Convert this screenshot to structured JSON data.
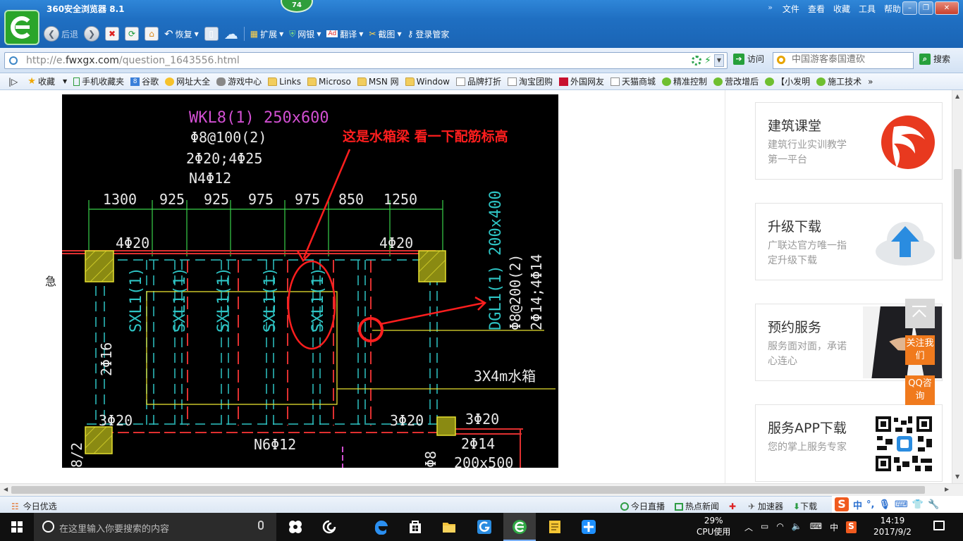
{
  "browser": {
    "title": "360安全浏览器 8.1",
    "badge": "74",
    "menu": [
      "文件",
      "查看",
      "收藏",
      "工具",
      "帮助"
    ],
    "nav": {
      "back": "后退",
      "restore": "恢复",
      "extend": "扩展",
      "bank": "网银",
      "translate": "翻译",
      "screenshot": "截图",
      "login_manager": "登录管家"
    },
    "address": {
      "prefix": "http://e.",
      "domain": "fwxgx.com",
      "path": "/question_1643556.html",
      "visit": "访问"
    },
    "search": {
      "placeholder": "中国游客泰国遭砍",
      "button": "搜索"
    },
    "favorites": [
      "收藏",
      "手机收藏夹",
      "谷歌",
      "网址大全",
      "游戏中心",
      "Links",
      "Microso",
      "MSN 网",
      "Window",
      "品牌打折",
      "淘宝团购",
      "外国网友",
      "天猫商城",
      "精准控制",
      "营改增后",
      "【小发明",
      "施工技术"
    ]
  },
  "page": {
    "left_label": "急",
    "drawing_annotation": "这是水箱梁 看一下配筋标高",
    "drawing_text": {
      "beam": "WKL8(1) 250x600",
      "stirrup": "Φ8@100(2)",
      "bars": "2Φ20;4Φ25",
      "torsion": "N4Φ12",
      "dims": [
        "1300",
        "925",
        "925",
        "975",
        "975",
        "850",
        "1250"
      ],
      "top_left": "4Φ20",
      "top_right": "4Φ20",
      "sxl": [
        "SXL1(1)",
        "SXL1(1)",
        "SXL1(1)",
        "SXL1(1)",
        "SXL1(1)"
      ],
      "dgl_1": "DGL1(1) 200x400",
      "dgl_2": "Φ8@200(2)",
      "dgl_3": "2Φ14;4Φ14",
      "side": "2Φ16",
      "tank": "3X4m水箱",
      "bl": "3Φ20",
      "bm": "3Φ20",
      "br": "3Φ20",
      "n6": "N6Φ12",
      "b2": "2Φ14",
      "b3": "200x500",
      "b4": "Φ8",
      "b5": "8/2"
    },
    "sidebar": [
      {
        "title": "建筑课堂",
        "sub": "建筑行业实训教学第一平台"
      },
      {
        "title": "升级下载",
        "sub": "广联达官方唯一指定升级下载"
      },
      {
        "title": "预约服务",
        "sub": "服务面对面，承诺心连心"
      },
      {
        "title": "服务APP下载",
        "sub": "您的掌上服务专家"
      }
    ],
    "float_follow": "关注我们",
    "float_qq": "QQ咨询"
  },
  "status": {
    "left": "今日优选",
    "live": "今日直播",
    "news": "热点新闻",
    "accelerator": "加速器",
    "download": "下载"
  },
  "ime": {
    "mode": "中"
  },
  "taskbar": {
    "search_placeholder": "在这里输入你要搜索的内容",
    "cpu_percent": "29%",
    "cpu_label": "CPU使用",
    "ime": "中",
    "time": "14:19",
    "date": "2017/9/2"
  }
}
